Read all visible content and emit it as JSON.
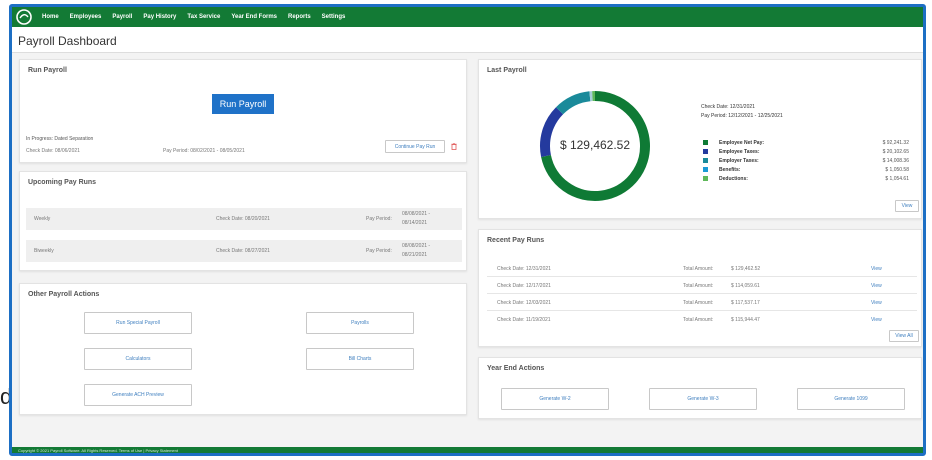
{
  "stray_letter": "d",
  "nav": {
    "items": [
      "Home",
      "Employees",
      "Payroll",
      "Pay History",
      "Tax Service",
      "Year End Forms",
      "Reports",
      "Settings"
    ]
  },
  "page": {
    "title": "Payroll Dashboard"
  },
  "run_payroll": {
    "title": "Run Payroll",
    "button": "Run Payroll",
    "in_progress": "In Progress: Dated Separation",
    "check_date": "Check Date: 08/06/2021",
    "pay_period": "Pay Period: 08/02/2021 - 08/05/2021",
    "continue_button": "Continue Pay Run"
  },
  "upcoming": {
    "title": "Upcoming Pay Runs",
    "rows": [
      {
        "name": "Weekly",
        "check_date": "Check Date: 08/20/2021",
        "pay_label": "Pay Period:",
        "period_start": "08/08/2021 -",
        "period_end": "08/14/2021"
      },
      {
        "name": "Biweekly",
        "check_date": "Check Date: 08/27/2021",
        "pay_label": "Pay Period:",
        "period_start": "08/08/2021 -",
        "period_end": "08/21/2021"
      }
    ]
  },
  "other_actions": {
    "title": "Other Payroll Actions",
    "buttons": [
      "Run Special Payroll",
      "Payrolls",
      "Calculators",
      "Bill Charts",
      "Generate ACH Preview"
    ]
  },
  "last_payroll": {
    "title": "Last Payroll",
    "total": "$ 129,462.52",
    "check_date": "Check Date: 12/31/2021",
    "pay_period": "Pay Period: 12/12/2021 - 12/25/2021",
    "legend": [
      {
        "label": "Employee Net Pay:",
        "value": "$ 92,241.32",
        "color": "#0f7a35"
      },
      {
        "label": "Employee Taxes:",
        "value": "$ 20,102.65",
        "color": "#243a9e"
      },
      {
        "label": "Employer Taxes:",
        "value": "$ 14,008.36",
        "color": "#1a8a9a"
      },
      {
        "label": "Benefits:",
        "value": "$ 1,050.58",
        "color": "#1b9ad6"
      },
      {
        "label": "Deductions:",
        "value": "$ 1,054.61",
        "color": "#5fb85a"
      }
    ],
    "view_button": "View"
  },
  "donut": {
    "values": [
      92241.32,
      20102.65,
      14008.36,
      1050.58,
      1054.61
    ],
    "colors": [
      "#0f7a35",
      "#243a9e",
      "#1a8a9a",
      "#a6cdd8",
      "#5fb85a"
    ]
  },
  "recent": {
    "title": "Recent Pay Runs",
    "rows": [
      {
        "check_date": "Check Date: 12/31/2021",
        "total_label": "Total Amount:",
        "amount": "$ 129,462.52",
        "link": "View"
      },
      {
        "check_date": "Check Date: 12/17/2021",
        "total_label": "Total Amount:",
        "amount": "$ 114,059.61",
        "link": "View"
      },
      {
        "check_date": "Check Date: 12/03/2021",
        "total_label": "Total Amount:",
        "amount": "$ 117,537.17",
        "link": "View"
      },
      {
        "check_date": "Check Date: 11/19/2021",
        "total_label": "Total Amount:",
        "amount": "$ 115,944.47",
        "link": "View"
      }
    ],
    "view_all": "View All"
  },
  "year_end": {
    "title": "Year End Actions",
    "buttons": [
      "Generate W-2",
      "Generate W-3",
      "Generate 1099"
    ]
  },
  "footer": {
    "text": "Copyright © 2021 Payroll Software. All Rights Reserved. Terms of Use | Privacy Statement"
  }
}
